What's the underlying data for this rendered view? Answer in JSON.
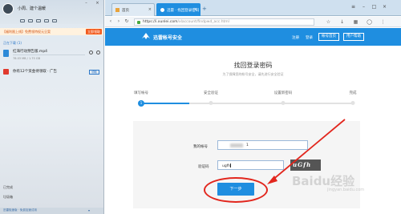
{
  "left_panel": {
    "user_name": "小周、建个温暖",
    "promo_text": "【福利限上线】免费领特权元旦案",
    "promo_button": "立即领取",
    "section_downloading": "正在下载 (1)",
    "downloads": [
      {
        "name": "红海行动预告版.mp4",
        "meta": "78.03 MB / 1.75 GB"
      }
    ],
    "ad": {
      "text": "你有12个资金待领取 · 广告",
      "button": "领取"
    },
    "section_done": "已完成",
    "section_trash": "垃圾箱",
    "statusbar_text": "迅雷极速版 · 免费加速试用"
  },
  "browser": {
    "tabs": [
      {
        "label": "首页",
        "active": false
      },
      {
        "label": "迅雷 · 找回登录密码",
        "active": true
      }
    ],
    "url": "https://i.xunlei.com",
    "url_tail": "/xlaccount/findpwd_acc.html"
  },
  "site": {
    "brand": "迅雷帐号安全",
    "header_links": [
      "注册",
      "登录"
    ],
    "header_buttons": [
      "帐号首页",
      "用户帮助"
    ],
    "page_title": "找回登录密码",
    "page_subtitle": "为了保障您的帐号安全，请先进行安全验证",
    "steps": [
      {
        "label": "填写帐号",
        "number": "1",
        "done": true
      },
      {
        "label": "安全验证",
        "number": "",
        "done": false
      },
      {
        "label": "设置新密码",
        "number": "",
        "done": false
      },
      {
        "label": "完成",
        "number": "",
        "done": false
      }
    ],
    "account_label": "我的帐号",
    "account_value": "1",
    "captcha_label": "验证码",
    "captcha_value": "ugfh",
    "captcha_image_text": "uGfh",
    "next_button": "下一步"
  },
  "watermark": {
    "main": "Baidu经验",
    "sub": "jingyan.baidu.com"
  },
  "colors": {
    "accent": "#1f8ee0",
    "annotation": "#e2261d"
  }
}
